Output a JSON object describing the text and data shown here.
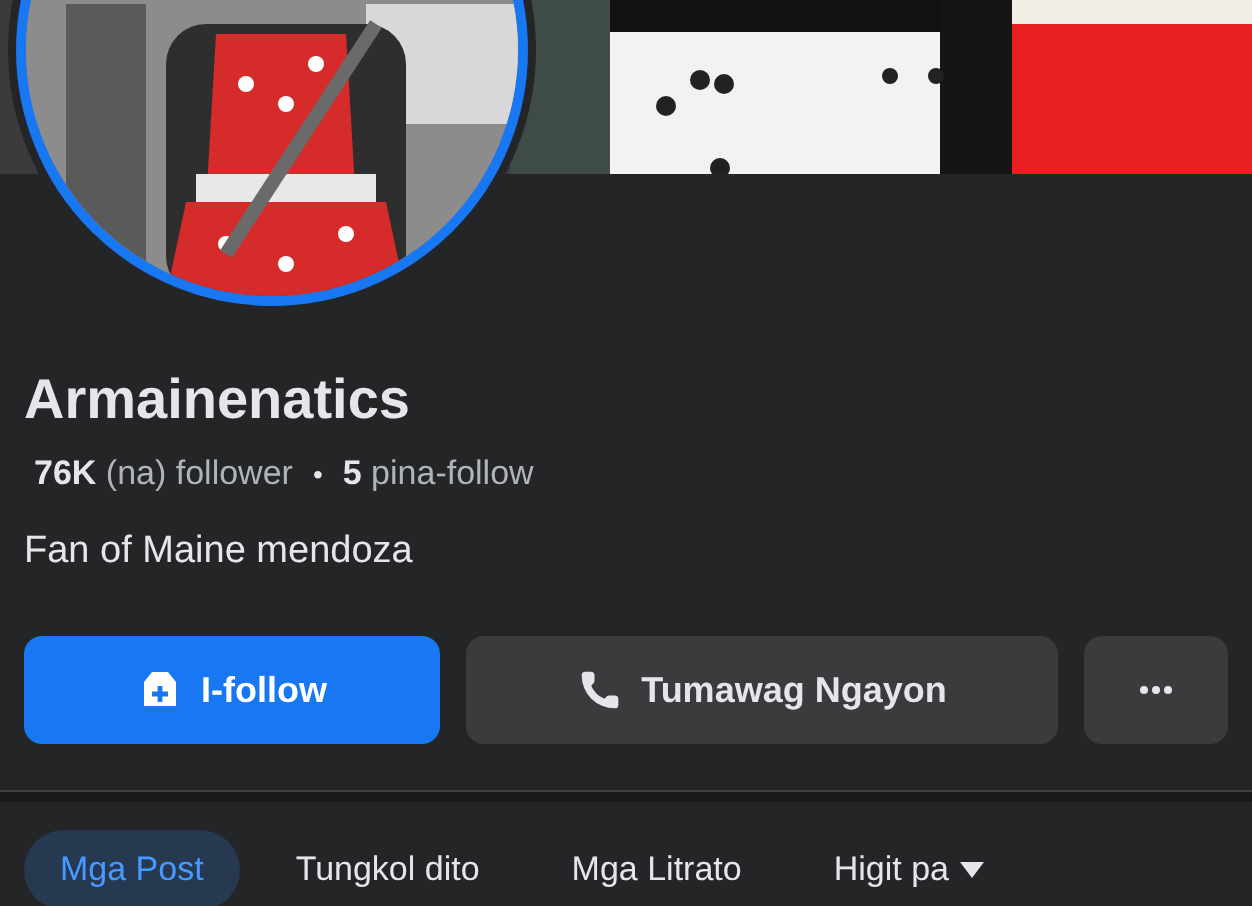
{
  "profile": {
    "name": "Armainenatics",
    "stats": [
      {
        "text": "**76K** (na) follower"
      },
      {
        "text": "**5** pina-follow"
      }
    ],
    "separator": "•",
    "bio": "Fan of Maine mendoza"
  },
  "actions": [
    {
      "kind": "follow",
      "label": "I-follow"
    },
    {
      "kind": "call",
      "label": "Tumawag Ngayon"
    },
    {
      "kind": "more"
    }
  ],
  "tabs": [
    {
      "label": "Mga Post",
      "selected": true
    },
    {
      "label": "Tungkol dito",
      "selected": false
    },
    {
      "label": "Mga Litrato",
      "selected": false
    },
    {
      "label": "Higit pa",
      "selected": false,
      "dropdown": true
    }
  ]
}
